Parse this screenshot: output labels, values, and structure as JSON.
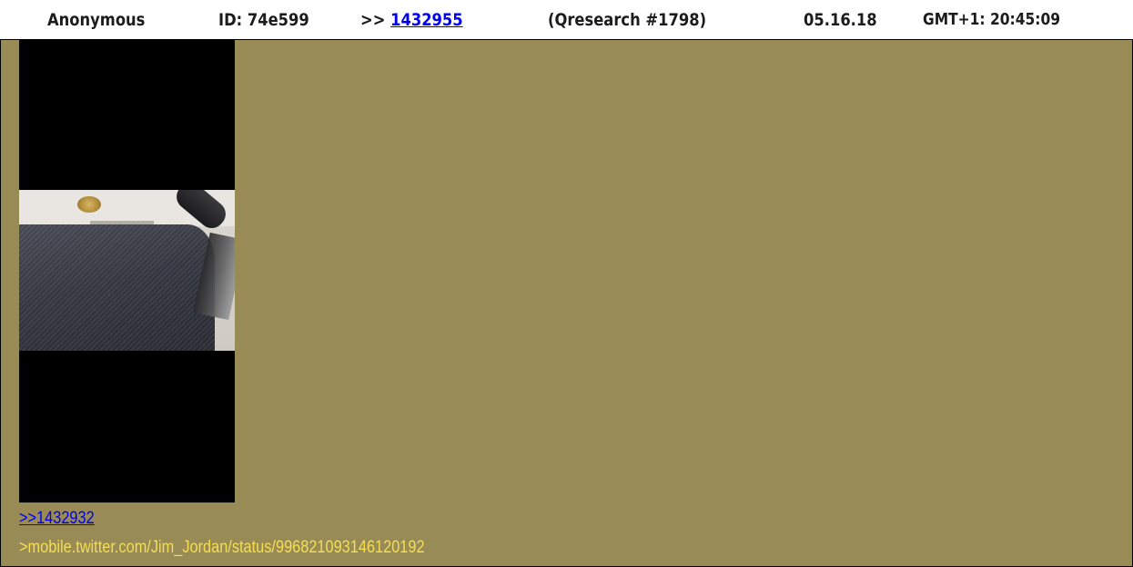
{
  "post": {
    "name": "Anonymous",
    "id": "ID: 74e599",
    "ref_prefix": ">>",
    "ref_number": "1432955",
    "bread": "(Qresearch #1798)",
    "date": "05.16.18",
    "time": "GMT+1: 20:45:09",
    "reply_link": ">>1432932",
    "greentext": ">mobile.twitter.com/Jim_Jordan/status/996821093146120192"
  },
  "colors": {
    "body_background": "#988b56",
    "link": "#0000ee",
    "greentext": "#f4de54",
    "header_text": "#1c1c1c"
  },
  "image": {
    "description_icon": "photo-thumbnail"
  }
}
